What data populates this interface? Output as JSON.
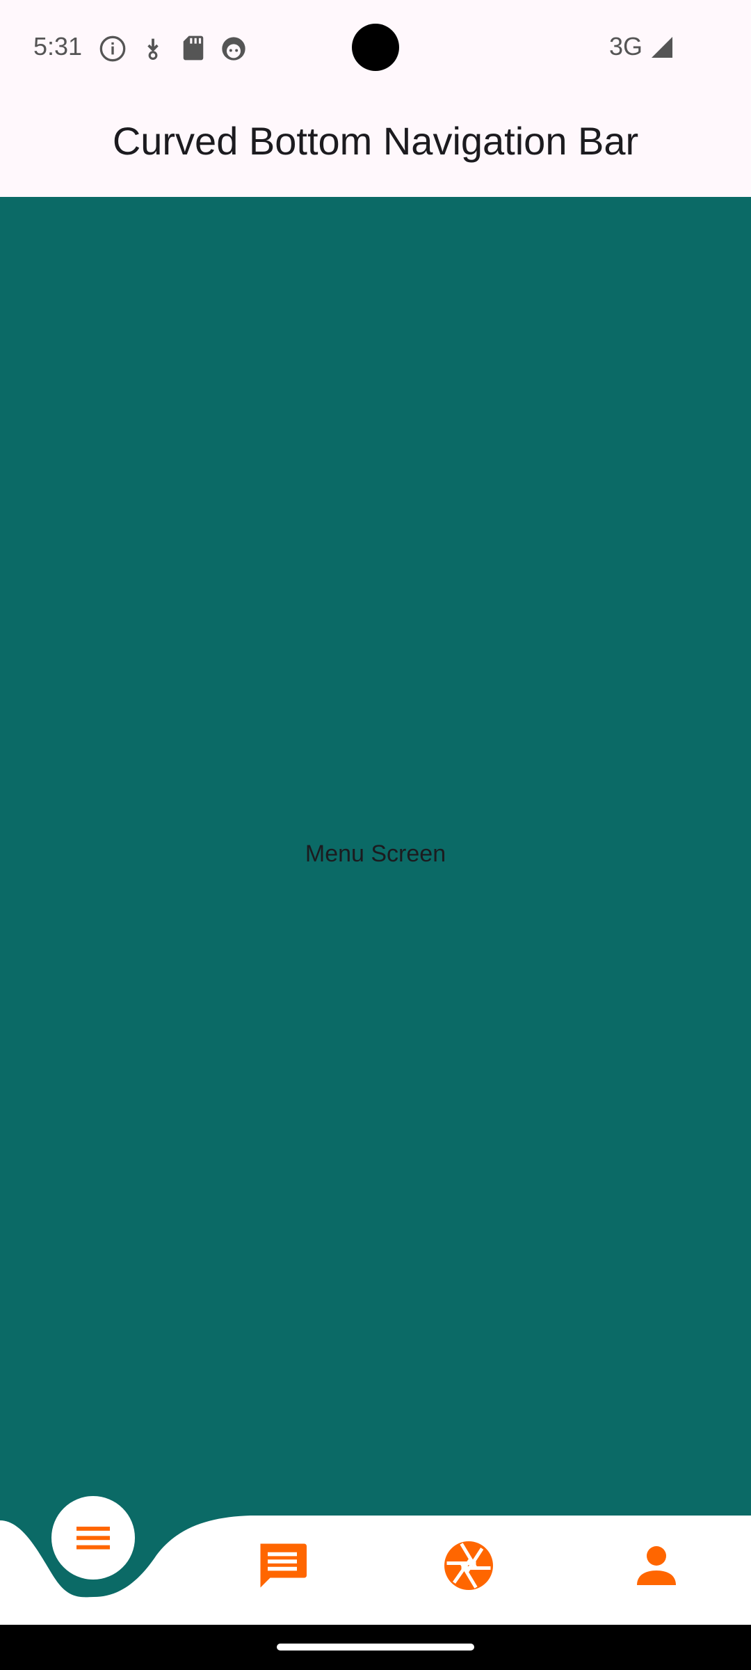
{
  "status_bar": {
    "time": "5:31",
    "network": "3G",
    "icons": [
      "info-icon",
      "download-icon",
      "sd-card-icon",
      "android-face-icon",
      "signal-icon"
    ]
  },
  "app_bar": {
    "title": "Curved Bottom Navigation Bar"
  },
  "main": {
    "screen_label": "Menu Screen"
  },
  "bottom_nav": {
    "items": [
      {
        "icon": "menu-icon",
        "selected": true
      },
      {
        "icon": "chat-icon",
        "selected": false
      },
      {
        "icon": "camera-aperture-icon",
        "selected": false
      },
      {
        "icon": "person-icon",
        "selected": false
      }
    ]
  },
  "colors": {
    "accent": "#FF6600",
    "background": "#0B6A66",
    "surface": "#FFFFFF",
    "app_bar": "#FFF8FC"
  }
}
